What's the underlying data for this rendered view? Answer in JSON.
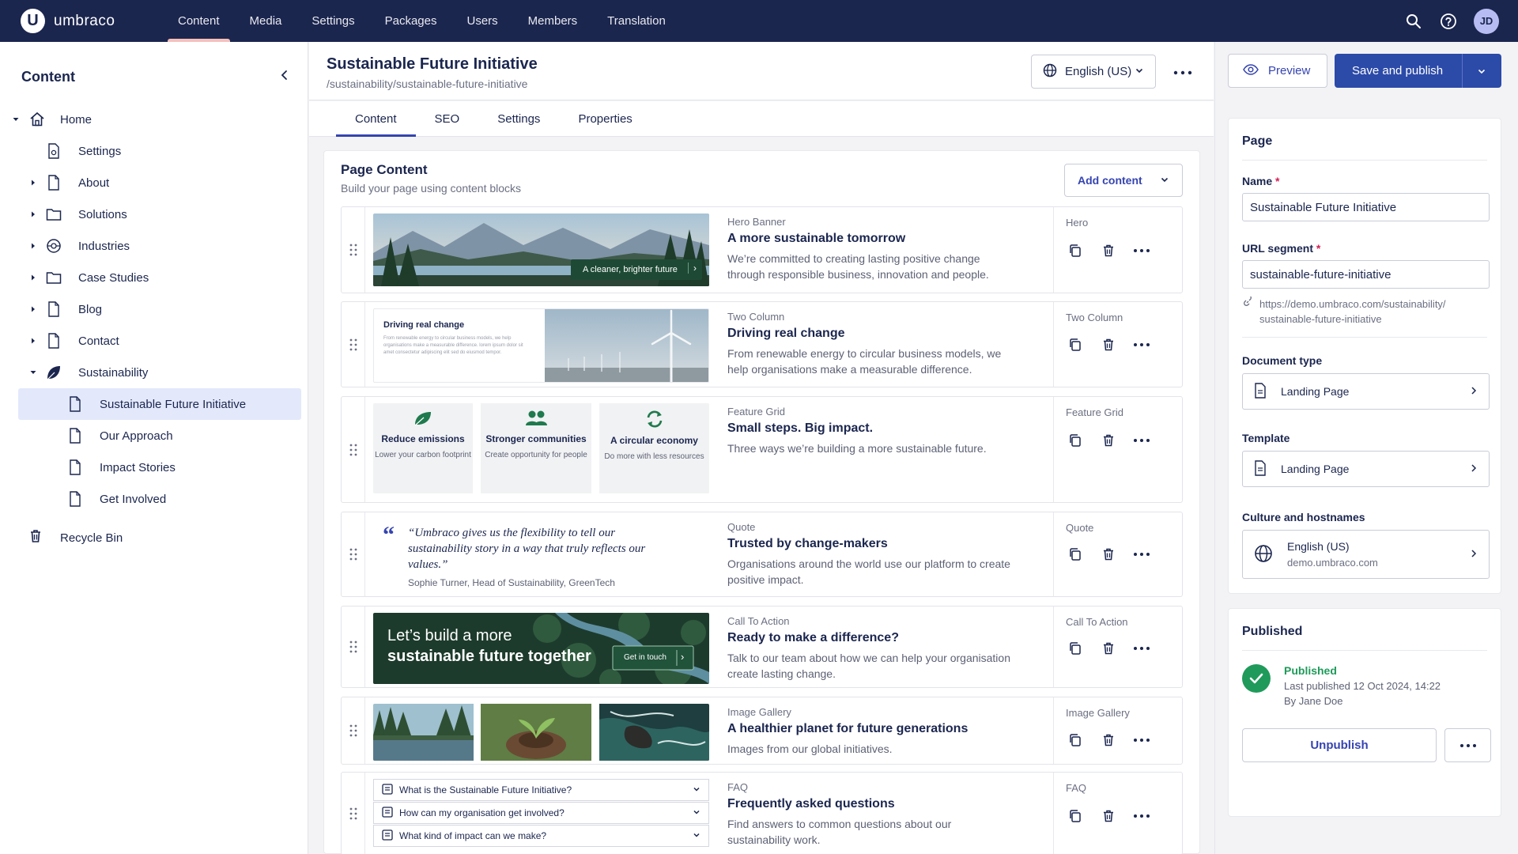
{
  "topbar": {
    "brand": "umbraco",
    "brand_initial": "U",
    "nav": [
      "Content",
      "Media",
      "Settings",
      "Packages",
      "Users",
      "Members",
      "Translation"
    ],
    "avatar_initials": "JD"
  },
  "sidebar": {
    "title": "Content",
    "tree": [
      {
        "label": "Home",
        "icon": "home-icon",
        "caret": "expanded"
      },
      {
        "label": "Settings",
        "icon": "settings-page-icon",
        "caret": "none"
      },
      {
        "label": "About",
        "icon": "page-icon",
        "caret": "collapsed"
      },
      {
        "label": "Solutions",
        "icon": "folder-icon",
        "caret": "collapsed"
      },
      {
        "label": "Industries",
        "icon": "industries-icon",
        "caret": "collapsed"
      },
      {
        "label": "Case Studies",
        "icon": "folder-icon",
        "caret": "collapsed"
      },
      {
        "label": "Blog",
        "icon": "page-icon",
        "caret": "collapsed"
      },
      {
        "label": "Contact",
        "icon": "page-icon",
        "caret": "collapsed"
      },
      {
        "label": "Sustainability",
        "icon": "leaf-icon",
        "caret": "expanded"
      },
      {
        "label": "Sustainable Future Initiative",
        "icon": "page-icon",
        "caret": "none",
        "selected": true
      },
      {
        "label": "Our Approach",
        "icon": "page-icon",
        "caret": "none"
      },
      {
        "label": "Impact Stories",
        "icon": "page-icon",
        "caret": "none"
      },
      {
        "label": "Get Involved",
        "icon": "page-icon",
        "caret": "none"
      }
    ],
    "recycle_bin": "Recycle Bin"
  },
  "header": {
    "title": "Sustainable Future Initiative",
    "path": "/sustainability/sustainable-future-initiative",
    "language": "English (US)"
  },
  "tabs": [
    "Content",
    "SEO",
    "Settings",
    "Properties"
  ],
  "panel": {
    "title": "Page Content",
    "subtitle": "Build your page using content blocks",
    "add_button": "Add content"
  },
  "blocks": [
    {
      "type": "Hero Banner",
      "side_label": "Hero",
      "title": "A more sustainable tomorrow",
      "desc": "We’re committed to creating lasting positive change through responsible business, innovation and people.",
      "preview": {
        "badge": "A cleaner, brighter future"
      }
    },
    {
      "type": "Two Column",
      "side_label": "Two Column",
      "title": "Driving real change",
      "desc": "From renewable energy to circular business models, we help organisations make a measurable difference.",
      "preview": {
        "heading": "Driving real change",
        "body": "From renewable energy to circular business models, we help organisations make a measurable difference. lorem ipsum dolor sit amet consectetur adipiscing elit sed do eiusmod tempor."
      }
    },
    {
      "type": "Feature Grid",
      "side_label": "Feature Grid",
      "title": "Small steps. Big impact.",
      "desc": "Three ways we’re building a more sustainable future.",
      "preview": {
        "tiles": [
          {
            "title": "Reduce emissions",
            "sub": "Lower your carbon footprint",
            "icon": "leaf-icon"
          },
          {
            "title": "Stronger communities",
            "sub": "Create opportunity for people",
            "icon": "people-icon"
          },
          {
            "title": "A circular economy",
            "sub": "Do more with less resources",
            "icon": "recycle-icon"
          }
        ]
      }
    },
    {
      "type": "Quote",
      "side_label": "Quote",
      "title": "Trusted by change-makers",
      "desc": "Organisations around the world use our platform to create positive impact.",
      "preview": {
        "quote": "“Umbraco gives us the flexibility to tell our sustainability story in a way that truly reflects our values.”",
        "author": "Sophie Turner, Head of Sustainability, GreenTech"
      }
    },
    {
      "type": "Call To Action",
      "side_label": "Call To Action",
      "title": "Ready to make a difference?",
      "desc": "Talk to our team about how we can help your organisation create lasting change.",
      "preview": {
        "line1": "Let’s build a more",
        "line2": "sustainable future together",
        "button": "Get in touch"
      }
    },
    {
      "type": "Image Gallery",
      "side_label": "Image Gallery",
      "title": "A healthier planet for future generations",
      "desc": "Images from our global initiatives."
    },
    {
      "type": "FAQ",
      "side_label": "FAQ",
      "title": "Frequently asked questions",
      "desc": "Find answers to common questions about our sustainability work.",
      "preview": {
        "questions": [
          "What is the Sustainable Future Initiative?",
          "How can my organisation get involved?",
          "What kind of impact can we make?"
        ]
      }
    }
  ],
  "right": {
    "preview_label": "Preview",
    "save_label": "Save and publish",
    "page_card": {
      "heading": "Page",
      "name_label": "Name",
      "name_value": "Sustainable Future Initiative",
      "url_label": "URL segment",
      "url_value": "sustainable-future-initiative",
      "url_hint_line1": "https://demo.umbraco.com/sustainability/",
      "url_hint_line2": "sustainable-future-initiative",
      "doctype_label": "Document type",
      "doctype_value": "Landing Page",
      "template_label": "Template",
      "template_value": "Landing Page",
      "culture_label": "Culture and hostnames",
      "culture_value": "English (US)",
      "culture_host": "demo.umbraco.com"
    },
    "published_card": {
      "heading": "Published",
      "status": "Published",
      "last": "Last published 12 Oct 2024, 14:22",
      "by": "By Jane Doe",
      "unpublish": "Unpublish"
    }
  },
  "colors": {
    "topbar": "#1b264f",
    "accent": "#3544b1",
    "primary_button": "#2c4aa8",
    "success": "#1f9a5a",
    "selected_bg": "#e3e9fb"
  }
}
